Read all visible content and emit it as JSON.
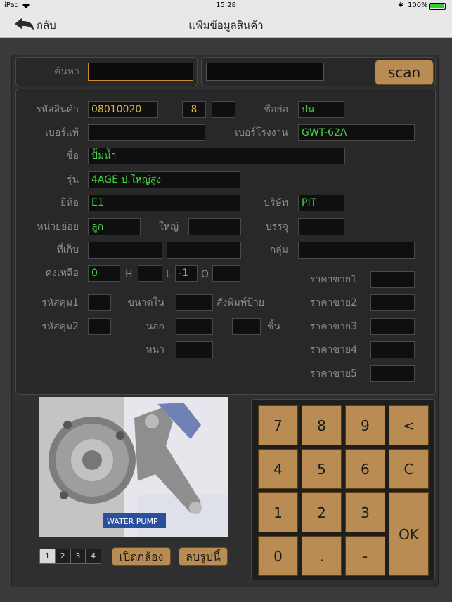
{
  "status": {
    "carrier": "iPad",
    "time": "15:28",
    "battery": "100%"
  },
  "nav": {
    "back_label": "กลับ",
    "title": "แฟ้มข้อมูลสินค้า"
  },
  "search": {
    "label": "ค้นหา",
    "value": "",
    "value2": "",
    "scan_label": "scan"
  },
  "form": {
    "code_label": "รหัสสินค้า",
    "code_value": "08010020",
    "code_num": "8",
    "code_num2": "",
    "short_label": "ชื่อย่อ",
    "short_value": "ปน",
    "real_no_label": "เบอร์แท้",
    "real_no_value": "",
    "factory_no_label": "เบอร์โรงงาน",
    "factory_no_value": "GWT-62A",
    "name_label": "ชื่อ",
    "name_value": "ปั้มน้ำ",
    "model_label": "รุ่น",
    "model_value": "4AGE ป.ใหญ่สูง",
    "brand_label": "ยี่ห้อ",
    "brand_value": "E1",
    "company_label": "บริษัท",
    "company_value": "PIT",
    "unit_label": "หน่วยย่อย",
    "unit_value": "ลูก",
    "big_label": "ใหญ่",
    "big_value": "",
    "pack_label": "บรรจุ",
    "pack_value": "",
    "store_label": "ที่เก็บ",
    "store_value1": "",
    "store_value2": "",
    "group_label": "กลุ่ม",
    "group_value": "",
    "remain_label": "คงเหลือ",
    "remain_value": "0",
    "h_label": "H",
    "h_value": "",
    "l_label": "L",
    "l_value": "-1",
    "o_label": "O",
    "o_value": "",
    "ctrl1_label": "รหัสคุม1",
    "ctrl1_value": "",
    "ctrl2_label": "รหัสคุม2",
    "ctrl2_value": "",
    "inner_label": "ขนาดใน",
    "inner_value": "",
    "outer_label": "นอก",
    "outer_value": "",
    "thick_label": "หนา",
    "thick_value": "",
    "print_label": "สั่งพิมพ์ป้าย",
    "print_value": "",
    "piece_label": "ชิ้น",
    "prices": [
      {
        "label": "ราคาขาย1",
        "value": ""
      },
      {
        "label": "ราคาขาย2",
        "value": ""
      },
      {
        "label": "ราคาขาย3",
        "value": ""
      },
      {
        "label": "ราคาขาย4",
        "value": ""
      },
      {
        "label": "ราคาขาย5",
        "value": ""
      }
    ]
  },
  "photo": {
    "pages": [
      "1",
      "2",
      "3",
      "4"
    ],
    "active_page": "1",
    "open_camera_label": "เปิดกล้อง",
    "delete_photo_label": "ลบรูปนี้",
    "box_text": "WATER PUMP"
  },
  "keypad": {
    "keys": [
      "7",
      "8",
      "9",
      "<",
      "4",
      "5",
      "6",
      "C",
      "1",
      "2",
      "3",
      "0",
      ".",
      "-"
    ],
    "ok_label": "OK"
  }
}
